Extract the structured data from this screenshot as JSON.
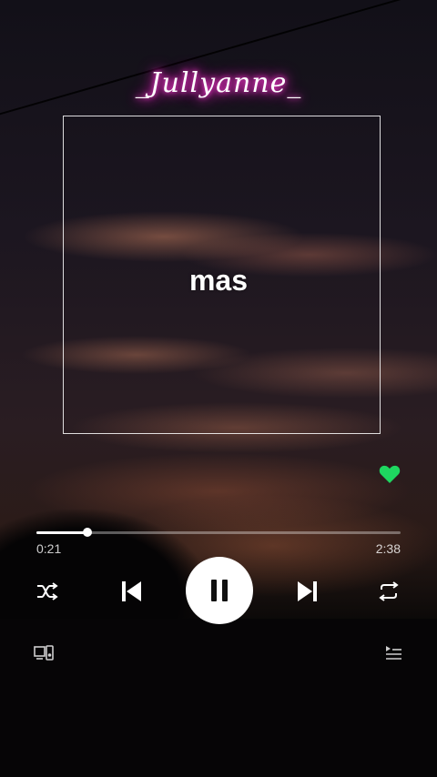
{
  "overlay": {
    "title": "_Jullyanne_"
  },
  "lyrics": {
    "current_line": "mas"
  },
  "player": {
    "liked": true,
    "progress_fraction": 0.14,
    "time_elapsed": "0:21",
    "time_total": "2:38",
    "controls": {
      "shuffle_icon": "shuffle-icon",
      "previous_icon": "skip-previous-icon",
      "play_state": "pause-icon",
      "next_icon": "skip-next-icon",
      "repeat_icon": "repeat-icon",
      "devices_icon": "connect-devices-icon",
      "queue_icon": "queue-icon"
    }
  },
  "colors": {
    "like_green": "#1ed760",
    "title_glow": "#ff2bcf"
  }
}
